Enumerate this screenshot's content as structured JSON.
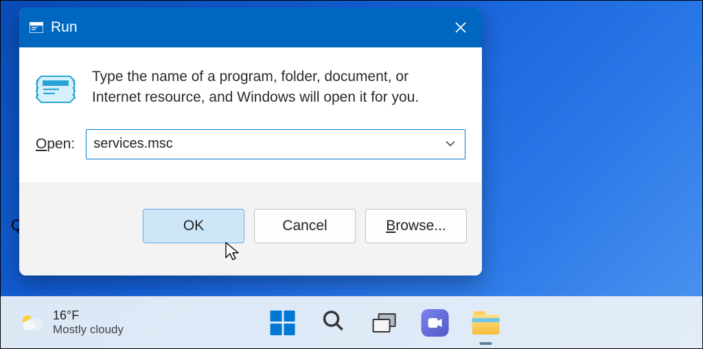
{
  "dialog": {
    "title": "Run",
    "description": "Type the name of a program, folder, document, or Internet resource, and Windows will open it for you.",
    "open_label_prefix": "O",
    "open_label_suffix": "pen:",
    "input_value": "services.msc",
    "buttons": {
      "ok": "OK",
      "cancel": "Cancel",
      "browse_prefix": "B",
      "browse_suffix": "rowse..."
    }
  },
  "taskbar": {
    "weather": {
      "temperature": "16°F",
      "condition": "Mostly cloudy"
    }
  }
}
